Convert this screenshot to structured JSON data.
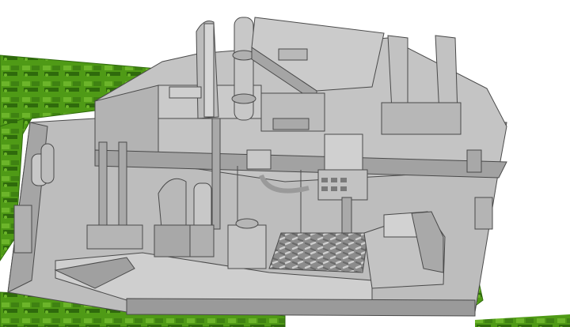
{
  "scene": {
    "palette": {
      "background": "#ffffff",
      "track_green": "#4f9a16",
      "track_green_dark": "#2f6a0c",
      "track_green_light": "#6cb52a",
      "hull_light": "#c9c9c9",
      "hull_mid": "#a9a9a9",
      "hull_dark": "#858585",
      "hull_shadow": "#6e6e6e",
      "edge_line": "#4a4a4a"
    },
    "components": [
      "left-track",
      "bottom-track",
      "hull-floor",
      "rear-bulkhead",
      "periscope-column",
      "hatch-plate",
      "vision-blocks",
      "instrument-panel",
      "steering-column",
      "treadplate-floor",
      "driver-seat-block",
      "side-wall-equipment"
    ]
  }
}
